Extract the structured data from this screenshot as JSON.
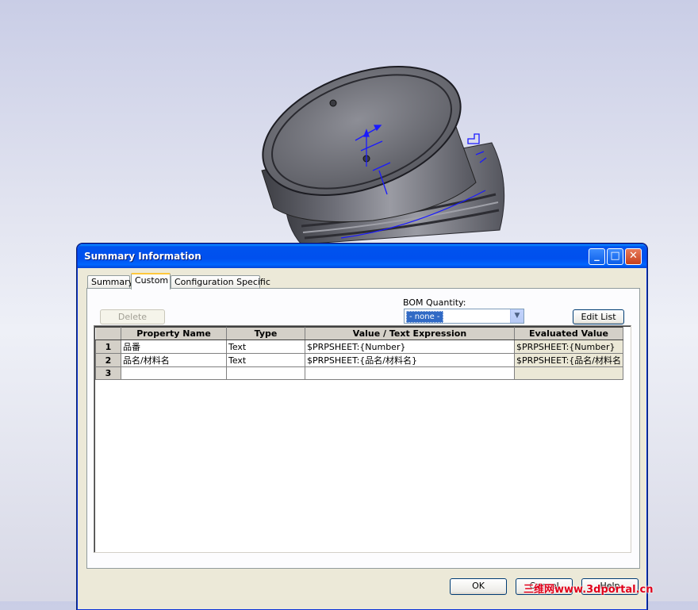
{
  "dialog": {
    "title": "Summary Information",
    "title_buttons": {
      "minimize": "_",
      "maximize": "□",
      "close": "✕"
    }
  },
  "tabs": [
    {
      "label": "Summary",
      "active": false
    },
    {
      "label": "Custom",
      "active": true
    },
    {
      "label": "Configuration Specific",
      "active": false
    }
  ],
  "toolbar": {
    "delete_label": "Delete",
    "delete_enabled": false,
    "bom_quantity_label": "BOM Quantity:",
    "bom_quantity_value": "- none -",
    "edit_list_label": "Edit List"
  },
  "grid": {
    "columns": [
      "Property Name",
      "Type",
      "Value / Text Expression",
      "Evaluated Value"
    ],
    "rows": [
      {
        "num": "1",
        "name": "品番",
        "type": "Text",
        "value": "$PRPSHEET:{Number}",
        "evaluated": "$PRPSHEET:{Number}"
      },
      {
        "num": "2",
        "name": "品名/材料名",
        "type": "Text",
        "value": "$PRPSHEET:{品名/材料名}",
        "evaluated": "$PRPSHEET:{品名/材料名"
      },
      {
        "num": "3",
        "name": "",
        "type": "",
        "value": "",
        "evaluated": ""
      }
    ]
  },
  "footer": {
    "ok_label": "OK",
    "cancel_label": "Cancel",
    "help_label": "Help"
  },
  "watermark": "三维网www.3dportal.cn",
  "colors": {
    "titlebar": "#0053ee",
    "sketch_blue": "#1a1aff",
    "part_gray": "#5f6068",
    "dialog_bg": "#ece9d8"
  }
}
